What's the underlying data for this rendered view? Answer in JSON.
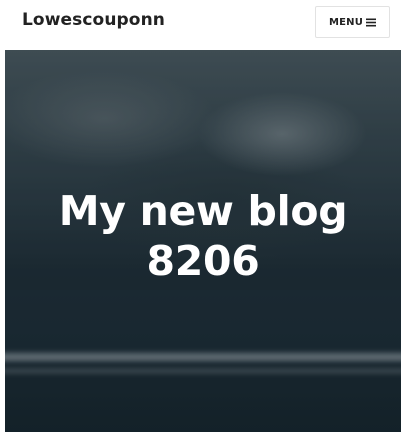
{
  "header": {
    "site_title": "Lowescouponn",
    "menu_label": "MENU",
    "menu_icon": "hamburger-icon"
  },
  "hero": {
    "title_line1": "My new blog",
    "title_line2": "8206",
    "background": "stormy sea photograph"
  },
  "colors": {
    "header_bg": "#ffffff",
    "title_text": "#222222",
    "hero_text": "#ffffff",
    "menu_border": "#e2e2e2"
  }
}
